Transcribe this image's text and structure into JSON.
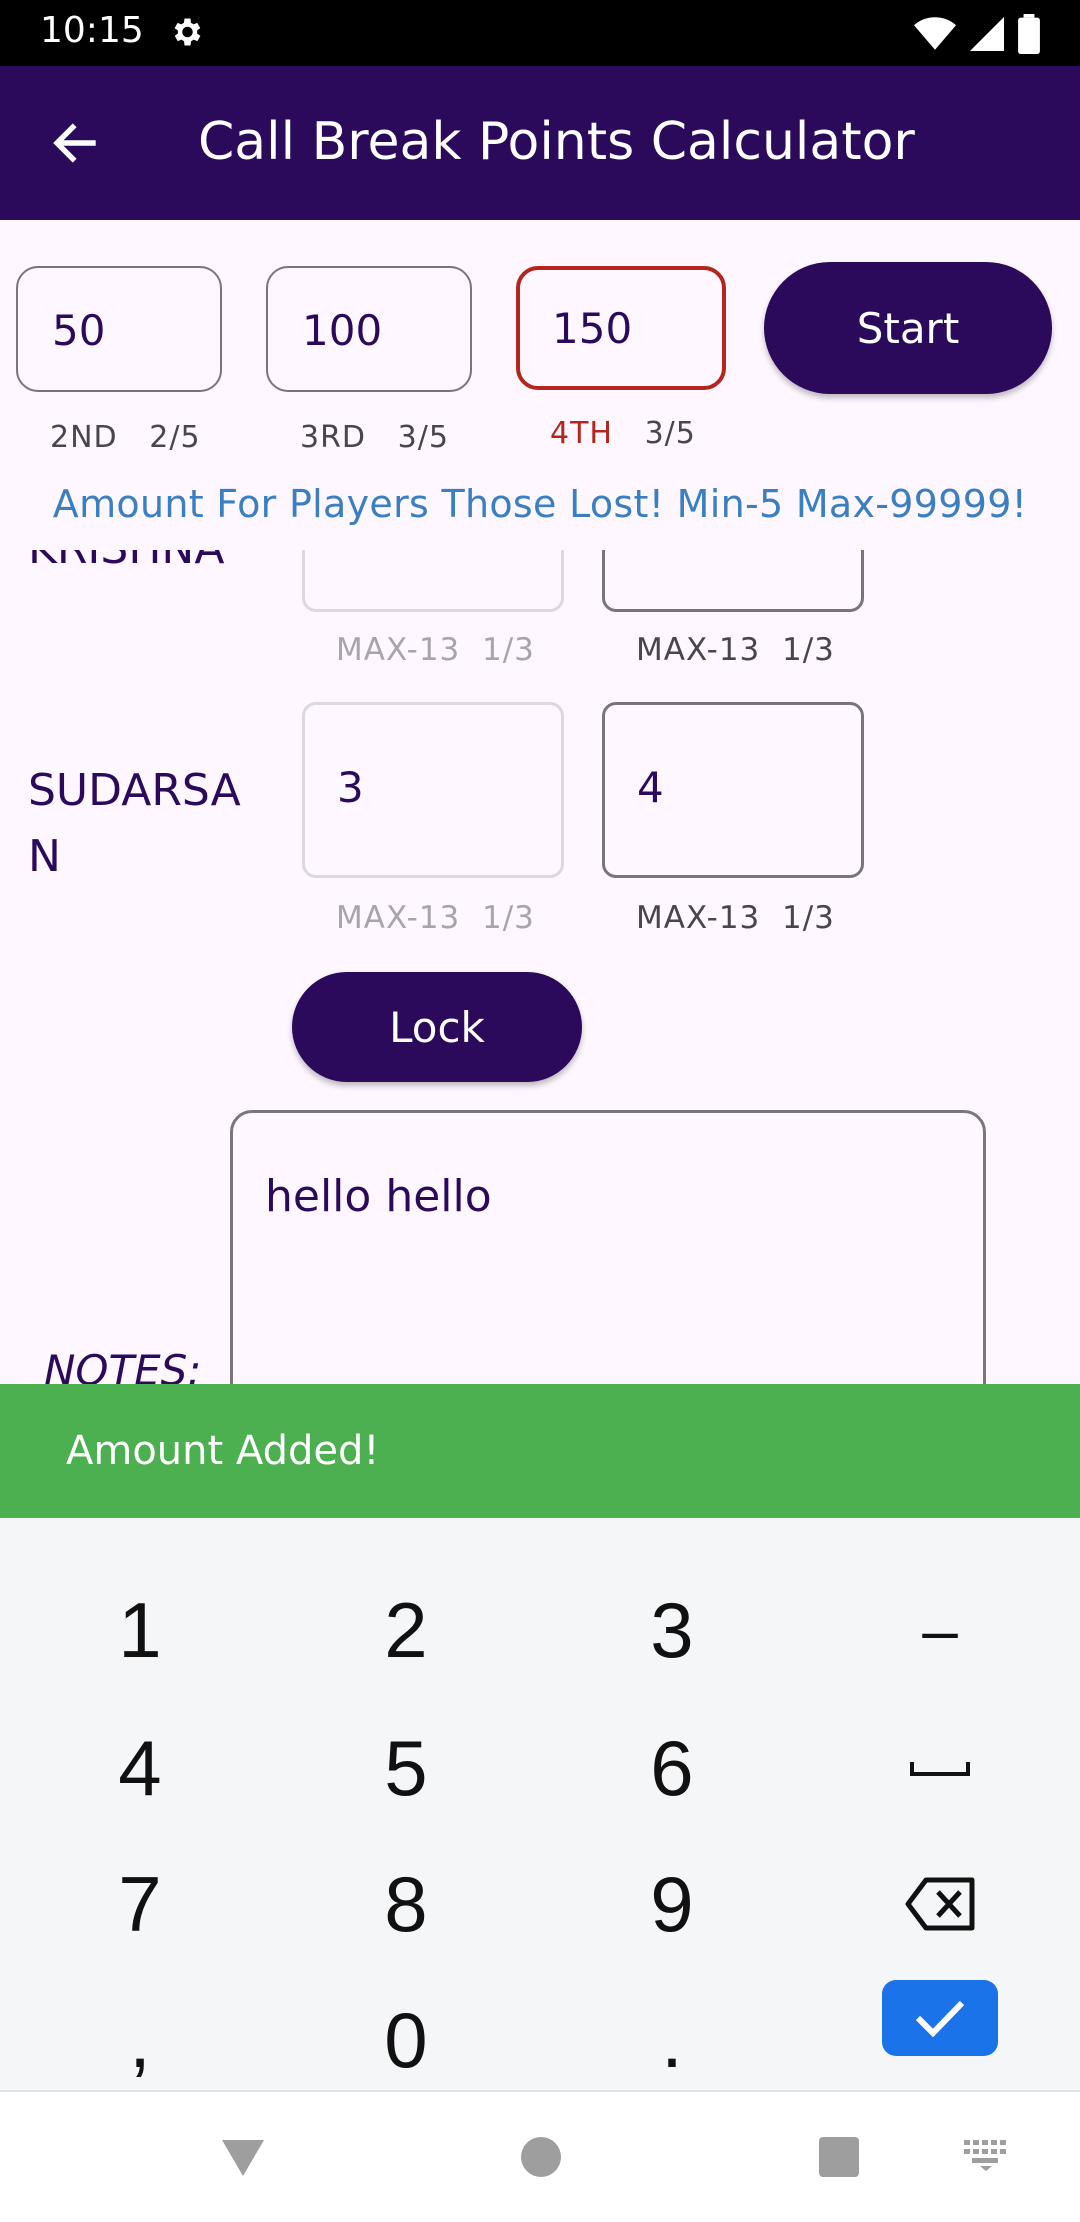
{
  "status_bar": {
    "time": "10:15"
  },
  "app_bar": {
    "title": "Call Break Points Calculator"
  },
  "amounts": {
    "fields": [
      {
        "value": "50",
        "position": "2ND",
        "count": "2/5",
        "error": false
      },
      {
        "value": "100",
        "position": "3RD",
        "count": "3/5",
        "error": false
      },
      {
        "value": "150",
        "position": "4TH",
        "count": "3/5",
        "error": true
      }
    ],
    "start_label": "Start",
    "info": "Amount For Players Those Lost! Min-5 Max-99999!"
  },
  "players": [
    {
      "name": "KRISHNA",
      "scores": [
        {
          "value": "",
          "helper": "MAX-13  1/3"
        },
        {
          "value": "",
          "helper": "MAX-13  1/3"
        }
      ]
    },
    {
      "name": "SUDARSAN",
      "scores": [
        {
          "value": "3",
          "helper": "MAX-13  1/3"
        },
        {
          "value": "4",
          "helper": "MAX-13  1/3"
        }
      ]
    }
  ],
  "lock_label": "Lock",
  "notes": {
    "label": "NOTES:",
    "value": "hello hello"
  },
  "snackbar": {
    "message": "Amount Added!"
  },
  "keyboard": {
    "rows": [
      [
        "1",
        "2",
        "3",
        "–"
      ],
      [
        "4",
        "5",
        "6",
        "␣"
      ],
      [
        "7",
        "8",
        "9",
        "⌫"
      ],
      [
        ",",
        "0",
        ".",
        "✓"
      ]
    ],
    "accent": "#1A73E8"
  },
  "colors": {
    "primary": "#2B0A5C",
    "error": "#B3261E",
    "snackbar": "#4CAF50",
    "info": "#3A7FC1"
  }
}
